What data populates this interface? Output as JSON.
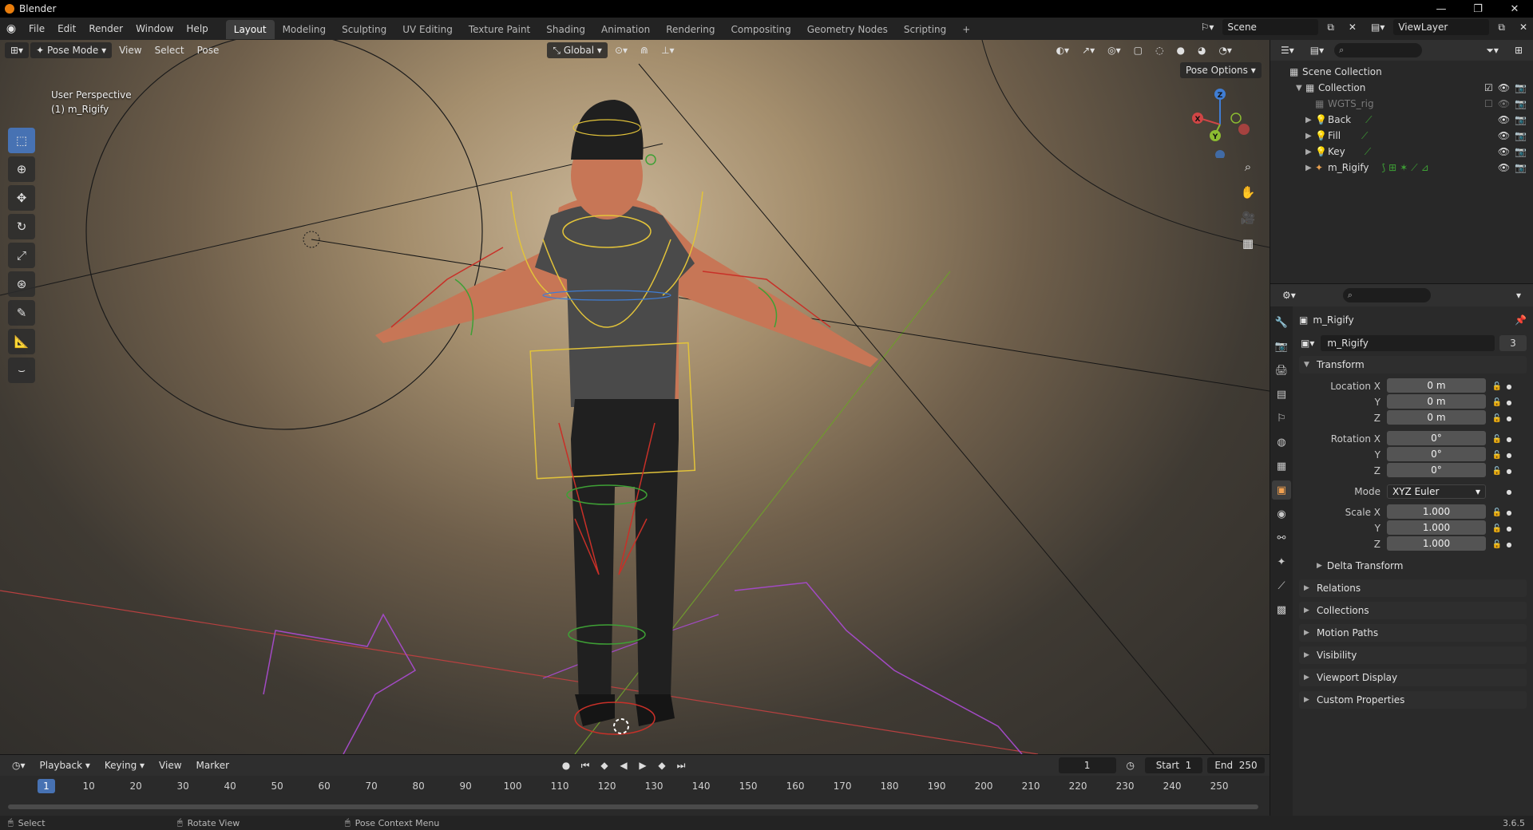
{
  "window": {
    "title": "Blender",
    "minimize": "—",
    "maximize": "❐",
    "close": "✕"
  },
  "menu": [
    "File",
    "Edit",
    "Render",
    "Window",
    "Help"
  ],
  "workspaces": [
    {
      "label": "Layout",
      "active": true
    },
    {
      "label": "Modeling"
    },
    {
      "label": "Sculpting"
    },
    {
      "label": "UV Editing"
    },
    {
      "label": "Texture Paint"
    },
    {
      "label": "Shading"
    },
    {
      "label": "Animation"
    },
    {
      "label": "Rendering"
    },
    {
      "label": "Compositing"
    },
    {
      "label": "Geometry Nodes"
    },
    {
      "label": "Scripting"
    }
  ],
  "add_workspace": "+",
  "scene_field": "Scene",
  "viewlayer_field": "ViewLayer",
  "viewport": {
    "mode": "Pose Mode",
    "menus": [
      "View",
      "Select",
      "Pose"
    ],
    "orientation": "Global",
    "pose_options": "Pose Options",
    "info_line1": "User Perspective",
    "info_line2": "(1) m_Rigify",
    "gizmo": {
      "x": "X",
      "y": "Y",
      "z": "Z"
    }
  },
  "timeline": {
    "menus": [
      "Playback",
      "Keying",
      "View",
      "Marker"
    ],
    "current_frame": "1",
    "start_label": "Start",
    "start": "1",
    "end_label": "End",
    "end": "250",
    "ticks": [
      "10",
      "20",
      "30",
      "40",
      "50",
      "60",
      "70",
      "80",
      "90",
      "100",
      "110",
      "120",
      "130",
      "140",
      "150",
      "160",
      "170",
      "180",
      "190",
      "200",
      "210",
      "220",
      "230",
      "240",
      "250"
    ],
    "playhead": "1"
  },
  "status": {
    "select": "Select",
    "rotate": "Rotate View",
    "context": "Pose Context Menu",
    "version": "3.6.5"
  },
  "outliner": {
    "scene_collection": "Scene Collection",
    "collection": "Collection",
    "items": [
      {
        "name": "WGTS_rig",
        "dim": true
      },
      {
        "name": "Back"
      },
      {
        "name": "Fill"
      },
      {
        "name": "Key"
      },
      {
        "name": "m_Rigify"
      }
    ]
  },
  "properties": {
    "object_name": "m_Rigify",
    "data_name": "m_Rigify",
    "users": "3",
    "transform_label": "Transform",
    "location_label": "Location X",
    "y_label": "Y",
    "z_label": "Z",
    "location": [
      "0 m",
      "0 m",
      "0 m"
    ],
    "rotation_label": "Rotation X",
    "rotation": [
      "0°",
      "0°",
      "0°"
    ],
    "mode_label": "Mode",
    "mode_value": "XYZ Euler",
    "scale_label": "Scale X",
    "scale": [
      "1.000",
      "1.000",
      "1.000"
    ],
    "delta": "Delta Transform",
    "panels": [
      "Relations",
      "Collections",
      "Motion Paths",
      "Visibility",
      "Viewport Display",
      "Custom Properties"
    ]
  },
  "colors": {
    "accent": "#4772b3",
    "x_axis": "#d04545",
    "y_axis": "#8cbc31",
    "z_axis": "#3f7dd4",
    "bone_yellow": "#e2c33a",
    "bone_red": "#c83028",
    "bone_green": "#3ea035",
    "widget_purple": "#a24ac4"
  }
}
